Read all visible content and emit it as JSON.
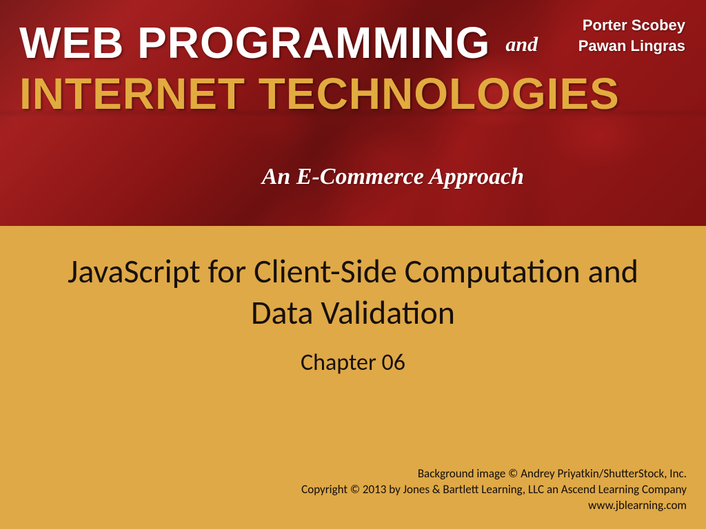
{
  "banner": {
    "title_line1": "WEB PROGRAMMING",
    "conjunction": "and",
    "title_line2": "INTERNET TECHNOLOGIES",
    "subtitle": "An E-Commerce Approach",
    "authors": {
      "author1": "Porter Scobey",
      "author2": "Pawan Lingras"
    }
  },
  "content": {
    "chapter_title": "JavaScript for Client-Side Computation and Data Validation",
    "chapter_label": "Chapter 06"
  },
  "credits": {
    "bg_credit": "Background image © Andrey Priyatkin/ShutterStock, Inc.",
    "copyright": "Copyright © 2013 by Jones & Bartlett Learning, LLC an Ascend Learning Company",
    "url": "www.jblearning.com"
  }
}
